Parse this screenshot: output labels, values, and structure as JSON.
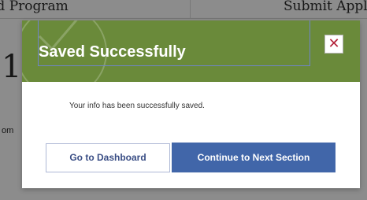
{
  "background_page": {
    "tab_left_label": "id Program",
    "tab_right_label": "Submit Appli",
    "big_char": "1",
    "small_text": "om"
  },
  "modal": {
    "title": "Saved Successfully",
    "close_symbol": "✕",
    "message": "Your info has been successfully saved.",
    "dashboard_button_label": "Go to Dashboard",
    "next_button_label": "Continue to Next Section",
    "header_color": "#6a8a3a",
    "primary_color": "#4166a9",
    "close_color": "#b4233a"
  },
  "icons": {
    "header_watermark": "check-circle-icon",
    "close": "close-icon"
  }
}
